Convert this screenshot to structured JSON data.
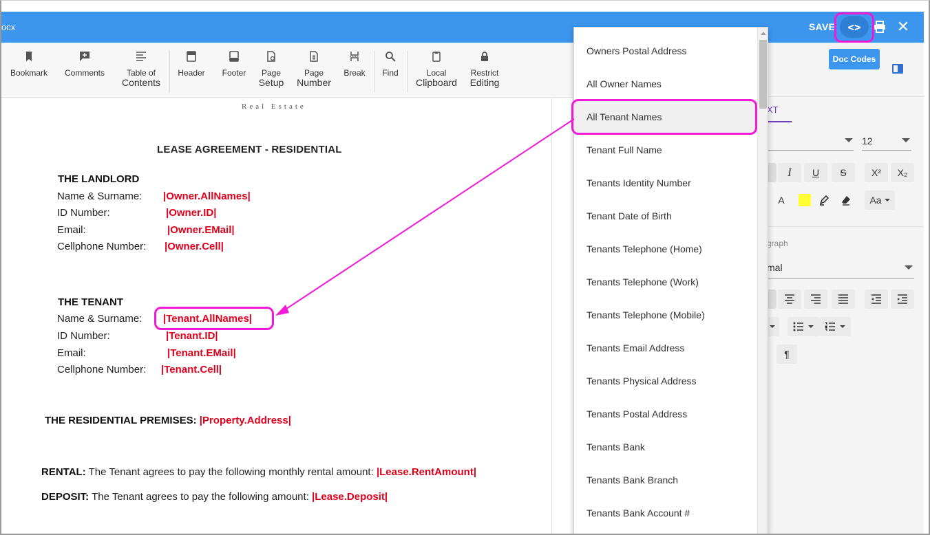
{
  "titlebar": {
    "file_name": "ocx",
    "save_label": "SAVE",
    "code_icon": "<>",
    "print_icon": "print-icon",
    "close_icon": "✕"
  },
  "toolbar": {
    "items": [
      {
        "label1": "Bookmark",
        "label2": "",
        "icon": "bookmark-icon"
      },
      {
        "label1": "Comments",
        "label2": "",
        "icon": "comment-add-icon"
      },
      {
        "label1": "Table of",
        "label2": "Contents",
        "icon": "toc-icon"
      },
      {
        "label1": "Header",
        "label2": "",
        "icon": "header-icon"
      },
      {
        "label1": "Footer",
        "label2": "",
        "icon": "footer-icon"
      },
      {
        "label1": "Page",
        "label2": "Setup",
        "icon": "page-setup-icon"
      },
      {
        "label1": "Page",
        "label2": "Number",
        "icon": "page-number-icon"
      },
      {
        "label1": "Break",
        "label2": "",
        "icon": "break-icon"
      },
      {
        "label1": "Find",
        "label2": "",
        "icon": "search-icon"
      },
      {
        "label1": "Local",
        "label2": "Clipboard",
        "icon": "clipboard-icon"
      },
      {
        "label1": "Restrict",
        "label2": "Editing",
        "icon": "lock-icon"
      }
    ]
  },
  "document": {
    "logo_text": "Real Estate",
    "title": "LEASE AGREEMENT - RESIDENTIAL",
    "landlord": {
      "heading": "THE LANDLORD",
      "rows": [
        {
          "label": "Name & Surname:",
          "code": "|Owner.AllNames|"
        },
        {
          "label": "ID Number:",
          "code": "|Owner.ID|"
        },
        {
          "label": "Email:",
          "code": "|Owner.EMail|"
        },
        {
          "label": "Cellphone Number:",
          "code": "|Owner.Cell|"
        }
      ]
    },
    "tenant": {
      "heading": "THE TENANT",
      "rows": [
        {
          "label": "Name & Surname:",
          "code": "|Tenant.AllNames|"
        },
        {
          "label": "ID Number:",
          "code": "|Tenant.ID|"
        },
        {
          "label": "Email:",
          "code": "|Tenant.EMail|"
        },
        {
          "label": "Cellphone Number:",
          "code": "|Tenant.Cell|"
        }
      ]
    },
    "premises": {
      "label": "THE RESIDENTIAL PREMISES:",
      "code": "|Property.Address|"
    },
    "rental": {
      "label": "RENTAL:",
      "text": "The Tenant agrees to pay the following monthly rental amount:",
      "code": "|Lease.RentAmount|"
    },
    "deposit": {
      "label": "DEPOSIT:",
      "text": "The Tenant agrees to pay the following amount:",
      "code": "|Lease.Deposit|"
    }
  },
  "right_panel": {
    "doc_codes_label": "Doc Codes",
    "tab_partial": "XT",
    "font_size": "12",
    "superscript": "X²",
    "subscript": "X₂",
    "font_color": "A",
    "change_case": "Aa",
    "paragraph_label_partial": "graph",
    "style_partial": "mal",
    "pilcrow": "¶",
    "accent_color": "#6a3fbf",
    "highlight_color": "#ffff33"
  },
  "dropdown": {
    "items": [
      "Owners Postal Address",
      "All Owner Names",
      "All Tenant Names",
      "Tenant Full Name",
      "Tenants Identity Number",
      "Tenant Date of Birth",
      "Tenants Telephone (Home)",
      "Tenants Telephone (Work)",
      "Tenants Telephone (Mobile)",
      "Tenants Email Address",
      "Tenants Physical Address",
      "Tenants Postal Address",
      "Tenants Bank",
      "Tenants Bank Branch",
      "Tenants Bank Account #"
    ],
    "selected": "All Tenant Names"
  },
  "colors": {
    "titlebar": "#3d96ee",
    "merge_code": "#e0001b",
    "annotation": "#f01ad8"
  }
}
